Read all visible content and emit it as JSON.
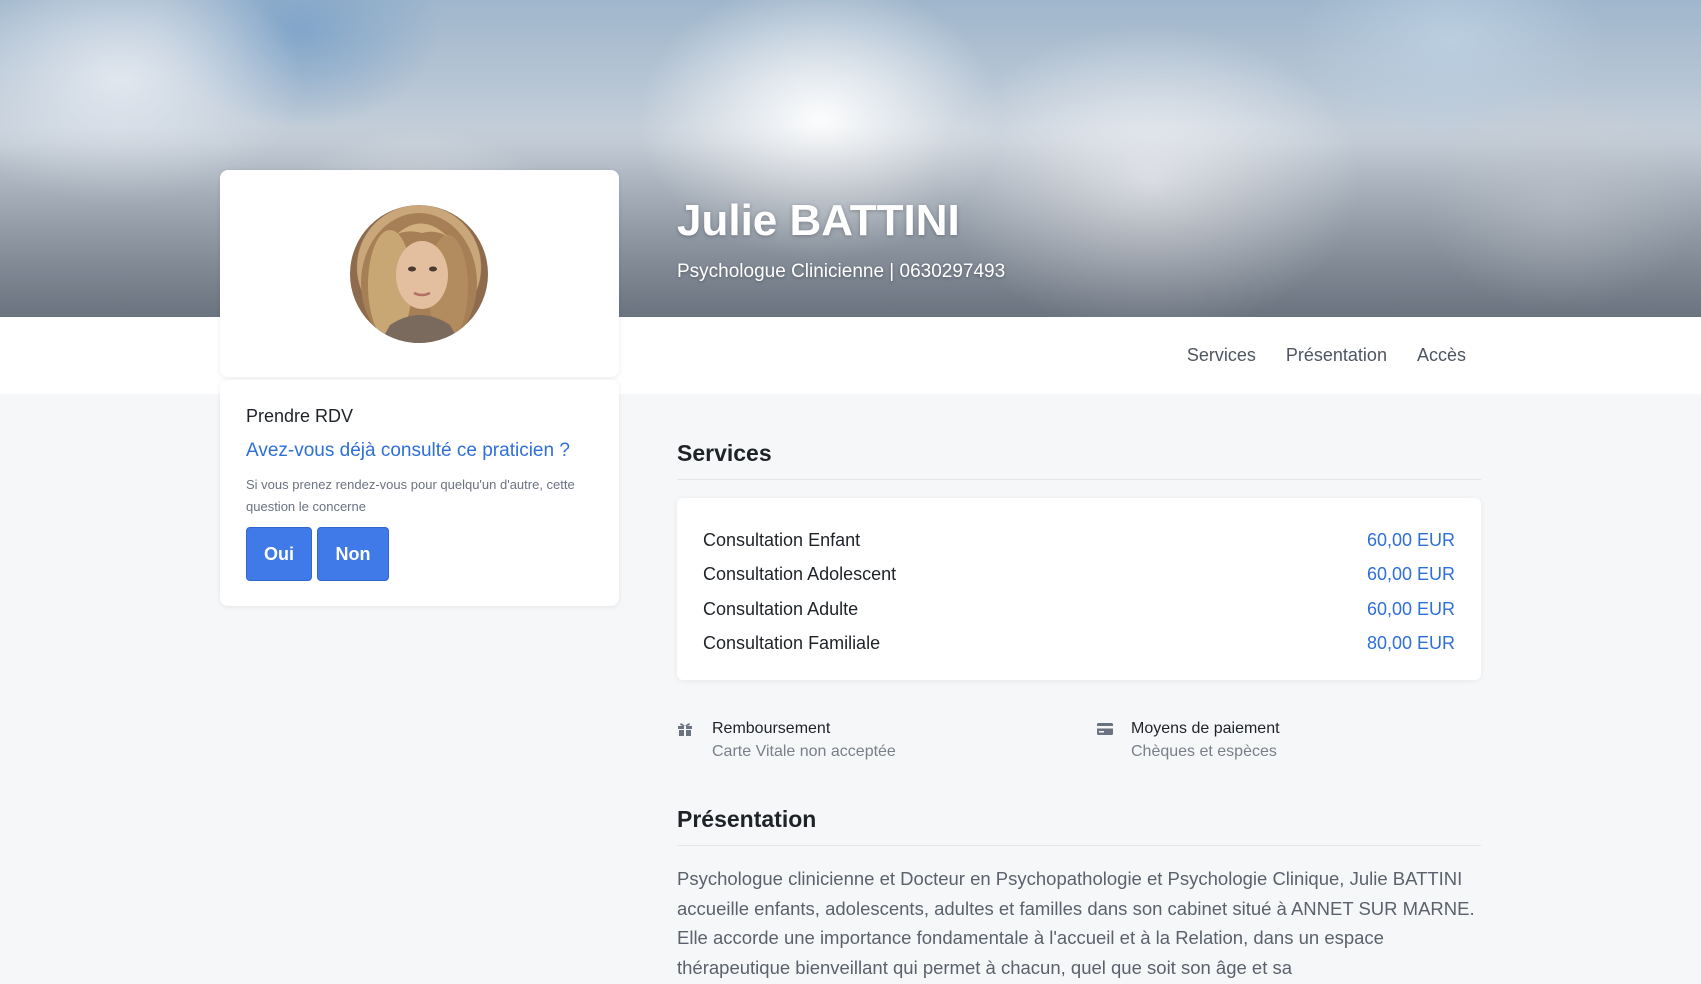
{
  "hero": {
    "name": "Julie BATTINI",
    "subtitle": "Psychologue Clinicienne | 0630297493"
  },
  "nav": {
    "items": [
      {
        "label": "Services"
      },
      {
        "label": "Présentation"
      },
      {
        "label": "Accès"
      }
    ]
  },
  "rdv": {
    "title": "Prendre RDV",
    "question": "Avez-vous déjà consulté ce praticien ?",
    "help": "Si vous prenez rendez-vous pour quelqu'un d'autre, cette question le concerne",
    "yes_label": "Oui",
    "no_label": "Non"
  },
  "services": {
    "title": "Services",
    "items": [
      {
        "name": "Consultation Enfant",
        "price": "60,00 EUR"
      },
      {
        "name": "Consultation Adolescent",
        "price": "60,00 EUR"
      },
      {
        "name": "Consultation Adulte",
        "price": "60,00 EUR"
      },
      {
        "name": "Consultation Familiale",
        "price": "80,00 EUR"
      }
    ]
  },
  "reimbursement": {
    "icon": "gift-icon",
    "label": "Remboursement",
    "value": "Carte Vitale non acceptée"
  },
  "payment": {
    "icon": "credit-card-icon",
    "label": "Moyens de paiement",
    "value": "Chèques et espèces"
  },
  "presentation": {
    "title": "Présentation",
    "text": "Psychologue clinicienne et Docteur en Psychopathologie et Psychologie Clinique, Julie BATTINI accueille enfants, adolescents, adultes et familles dans son cabinet situé à ANNET SUR MARNE. Elle accorde une importance fondamentale à l'accueil et à la Relation, dans un espace thérapeutique bienveillant qui permet à chacun, quel que soit son âge et sa"
  },
  "colors": {
    "accent": "#3f7ae8",
    "link": "#2f6fd8",
    "background": "#f6f7f9"
  }
}
